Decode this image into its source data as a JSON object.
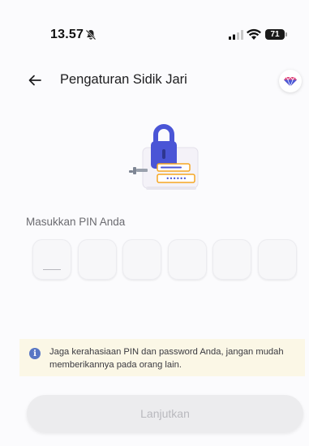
{
  "status_bar": {
    "time": "13.57",
    "battery": "71",
    "icons": [
      "bell-muted-icon",
      "signal-icon",
      "wifi-icon",
      "battery-icon"
    ]
  },
  "header": {
    "back_icon": "arrow-left-icon",
    "title": "Pengaturan Sidik Jari",
    "help_icon": "gem-icon"
  },
  "illustration": {
    "icon": "padlock-password-card-icon",
    "password_mask": "••••••"
  },
  "pin": {
    "label": "Masukkan PIN Anda",
    "length": 6,
    "filled": 0
  },
  "info": {
    "icon": "info-icon",
    "icon_glyph": "i",
    "text": "Jaga kerahasiaan PIN dan password Anda, jangan mudah memberikannya pada orang lain."
  },
  "actions": {
    "continue_label": "Lanjutkan"
  },
  "colors": {
    "accent": "#4a55d6",
    "banner_bg": "#fbf7e6",
    "info_icon": "#5876c4",
    "button_disabled_bg": "#ececee",
    "button_disabled_text": "#b9b9be"
  }
}
